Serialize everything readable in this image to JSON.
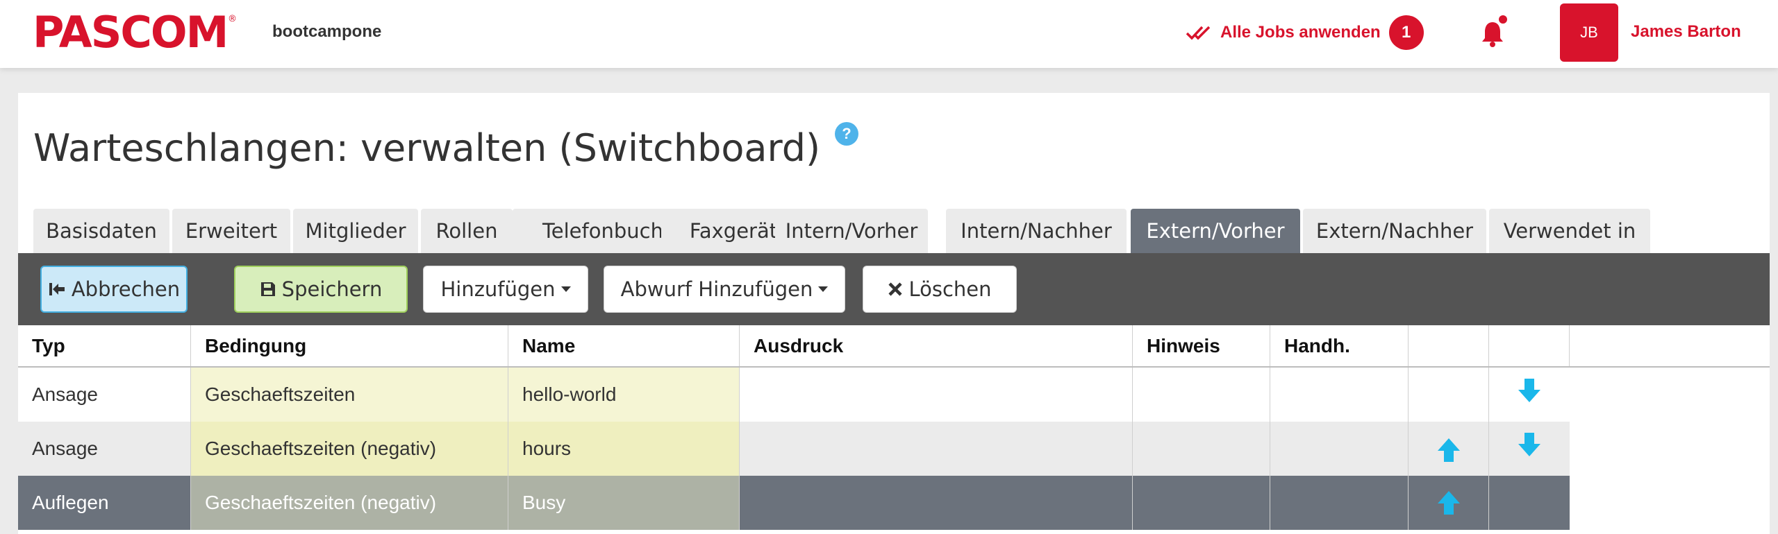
{
  "header": {
    "logo": "PASCOM",
    "logo_reg": "®",
    "tenant": "bootcampone",
    "jobs_label": "Alle Jobs anwenden",
    "jobs_count": "1",
    "user_initials": "JB",
    "user_name": "James Barton"
  },
  "page": {
    "title": "Warteschlangen: verwalten (Switchboard)",
    "help": "?"
  },
  "tabs": [
    {
      "label": "Basisdaten",
      "active": false
    },
    {
      "label": "Erweitert",
      "active": false
    },
    {
      "label": "Mitglieder",
      "active": false
    },
    {
      "label": "Rollen",
      "active": false
    },
    {
      "label": "Telefonbuch",
      "active": false
    },
    {
      "label": "Faxgerät",
      "active": false
    },
    {
      "label": "Intern/Vorher",
      "active": false
    },
    {
      "label": "Intern/Nachher",
      "active": false
    },
    {
      "label": "Extern/Vorher",
      "active": true
    },
    {
      "label": "Extern/Nachher",
      "active": false
    },
    {
      "label": "Verwendet in",
      "active": false
    }
  ],
  "toolbar": {
    "cancel": "Abbrechen",
    "save": "Speichern",
    "add": "Hinzufügen",
    "add_drop": "Abwurf Hinzufügen",
    "delete": "Löschen"
  },
  "table": {
    "columns": [
      "Typ",
      "Bedingung",
      "Name",
      "Ausdruck",
      "Hinweis",
      "Handh.",
      "",
      ""
    ],
    "rows": [
      {
        "typ": "Ansage",
        "bedingung": "Geschaeftszeiten",
        "name": "hello-world",
        "ausdruck": "",
        "hinweis": "",
        "handh": "",
        "up": false,
        "down": true,
        "selected": false
      },
      {
        "typ": "Ansage",
        "bedingung": "Geschaeftszeiten (negativ)",
        "name": "hours",
        "ausdruck": "",
        "hinweis": "",
        "handh": "",
        "up": true,
        "down": true,
        "selected": false
      },
      {
        "typ": "Auflegen",
        "bedingung": "Geschaeftszeiten (negativ)",
        "name": "Busy",
        "ausdruck": "",
        "hinweis": "",
        "handh": "",
        "up": true,
        "down": false,
        "selected": true
      }
    ]
  },
  "colors": {
    "brand": "#d8132c",
    "active_tab": "#6b727c",
    "toolbar": "#545454",
    "arrow": "#1ab7ea",
    "highlight": "#f5f5d4"
  }
}
